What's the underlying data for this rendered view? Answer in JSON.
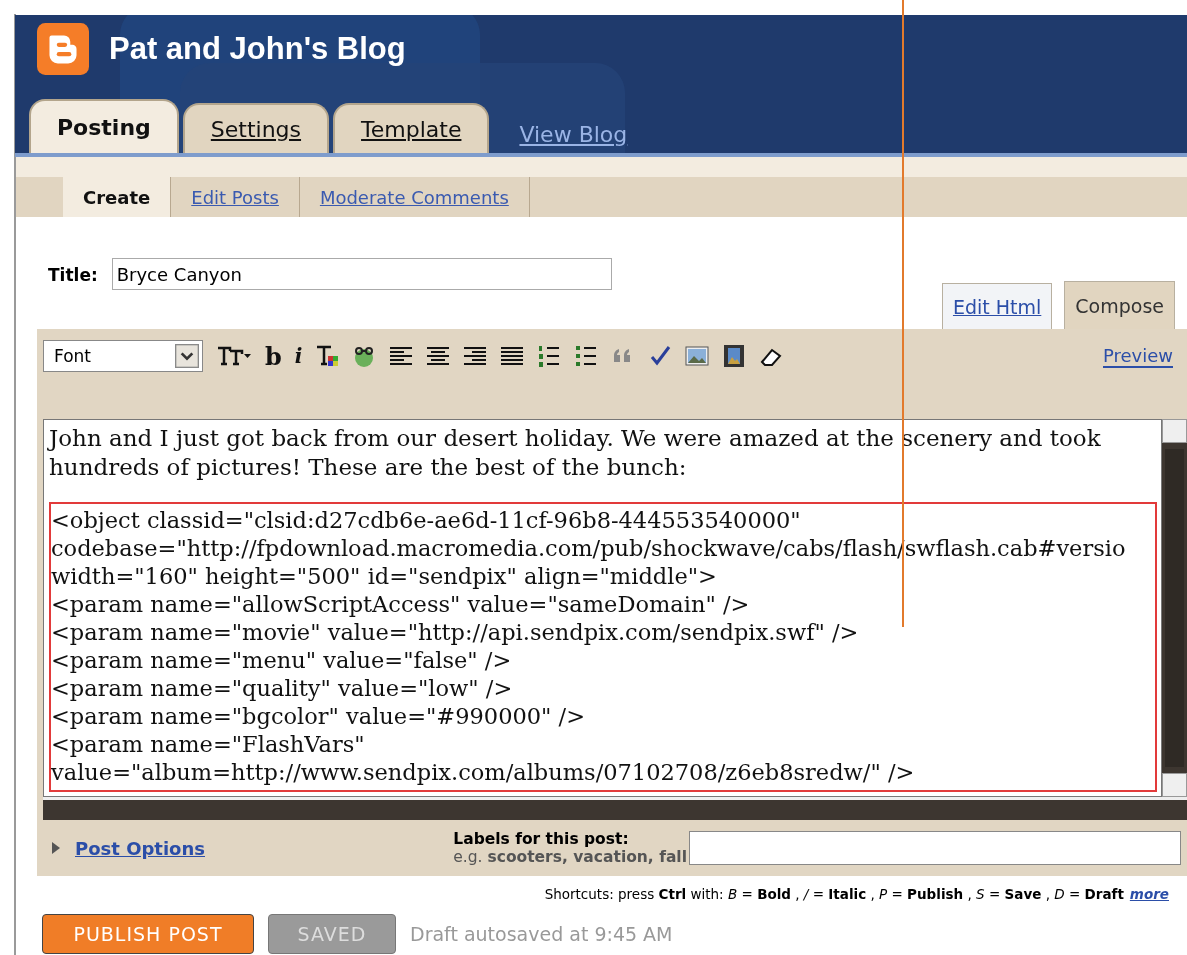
{
  "header": {
    "title": "Pat and John's Blog"
  },
  "tabs": [
    {
      "label": "Posting",
      "selected": true
    },
    {
      "label": "Settings",
      "selected": false
    },
    {
      "label": "Template",
      "selected": false
    }
  ],
  "view_blog": "View Blog",
  "subtabs": [
    {
      "label": "Create",
      "selected": true
    },
    {
      "label": "Edit Posts",
      "selected": false
    },
    {
      "label": "Moderate Comments",
      "selected": false
    }
  ],
  "title_field": {
    "label": "Title:",
    "value": "Bryce Canyon"
  },
  "mode_tabs": [
    {
      "label": "Edit Html",
      "selected": false
    },
    {
      "label": "Compose",
      "selected": true
    }
  ],
  "toolbar": {
    "font_select": "Font",
    "preview": "Preview",
    "items": [
      {
        "kind": "fontsize"
      },
      {
        "kind": "bold",
        "label": "b"
      },
      {
        "kind": "italic",
        "label": "i"
      },
      {
        "kind": "color"
      },
      {
        "kind": "link"
      },
      {
        "kind": "alignleft"
      },
      {
        "kind": "aligncenter"
      },
      {
        "kind": "alignright"
      },
      {
        "kind": "justify"
      },
      {
        "kind": "numbered"
      },
      {
        "kind": "bullets"
      },
      {
        "kind": "quote"
      },
      {
        "kind": "spell"
      },
      {
        "kind": "image"
      },
      {
        "kind": "video"
      },
      {
        "kind": "eraser"
      }
    ]
  },
  "editor": {
    "paragraph": "John and I just got back from our desert holiday. We were amazed at the scenery and took hundreds of pictures! These are the best of the bunch:",
    "code_lines": [
      "<object classid=\"clsid:d27cdb6e-ae6d-11cf-96b8-444553540000\"",
      "codebase=\"http://fpdownload.macromedia.com/pub/shockwave/cabs/flash/swflash.cab#versio",
      "width=\"160\" height=\"500\" id=\"sendpix\" align=\"middle\">",
      "<param name=\"allowScriptAccess\" value=\"sameDomain\" />",
      "<param name=\"movie\" value=\"http://api.sendpix.com/sendpix.swf\" />",
      "<param name=\"menu\" value=\"false\" />",
      "<param name=\"quality\" value=\"low\" />",
      "<param name=\"bgcolor\" value=\"#990000\" />",
      "<param name=\"FlashVars\"",
      "value=\"album=http://www.sendpix.com/albums/07102708/z6eb8sredw/\" />"
    ]
  },
  "post_options": "Post Options",
  "labels": {
    "label": "Labels for this post:",
    "hint": "e.g. **scooters, vacation, fall**"
  },
  "shortcuts": {
    "text": "Shortcuts: press **Ctrl** with: *B* = **Bold** , */* = **Italic** , *P* = **Publish** , *S* = **Save** , *D* = **Draft**",
    "link": "more"
  },
  "buttons": [
    {
      "label": "PUBLISH POST",
      "disabled": false
    },
    {
      "label": "SAVED",
      "disabled": true
    }
  ],
  "status": "Draft autosaved at 9:45 AM"
}
